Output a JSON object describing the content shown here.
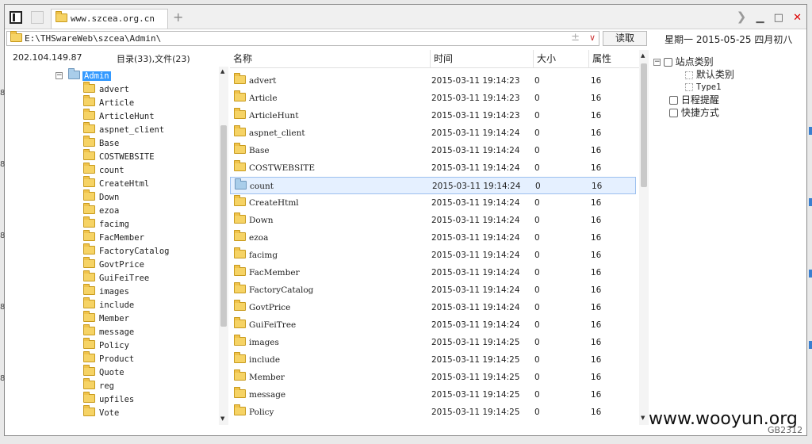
{
  "tab": {
    "title": "www.szcea.org.cn"
  },
  "address": {
    "path": "E:\\THSwareWeb\\szcea\\Admin\\",
    "read_button": "读取"
  },
  "date_display": "星期一  2015-05-25  四月初八",
  "status": {
    "ip": "202.104.149.87",
    "counts": "目录(33),文件(23)"
  },
  "tree": {
    "root": "Admin",
    "items": [
      "advert",
      "Article",
      "ArticleHunt",
      "aspnet_client",
      "Base",
      "COSTWEBSITE",
      "count",
      "CreateHtml",
      "Down",
      "ezoa",
      "facimg",
      "FacMember",
      "FactoryCatalog",
      "GovtPrice",
      "GuiFeiTree",
      "images",
      "include",
      "Member",
      "message",
      "Policy",
      "Product",
      "Quote",
      "reg",
      "upfiles",
      "Vote"
    ]
  },
  "list": {
    "columns": [
      "名称",
      "时间",
      "大小",
      "属性"
    ],
    "rows": [
      {
        "name": "advert",
        "time": "2015-03-11 19:14:23",
        "size": "0",
        "attr": "16"
      },
      {
        "name": "Article",
        "time": "2015-03-11 19:14:23",
        "size": "0",
        "attr": "16"
      },
      {
        "name": "ArticleHunt",
        "time": "2015-03-11 19:14:23",
        "size": "0",
        "attr": "16"
      },
      {
        "name": "aspnet_client",
        "time": "2015-03-11 19:14:24",
        "size": "0",
        "attr": "16"
      },
      {
        "name": "Base",
        "time": "2015-03-11 19:14:24",
        "size": "0",
        "attr": "16"
      },
      {
        "name": "COSTWEBSITE",
        "time": "2015-03-11 19:14:24",
        "size": "0",
        "attr": "16"
      },
      {
        "name": "count",
        "time": "2015-03-11 19:14:24",
        "size": "0",
        "attr": "16",
        "selected": true
      },
      {
        "name": "CreateHtml",
        "time": "2015-03-11 19:14:24",
        "size": "0",
        "attr": "16"
      },
      {
        "name": "Down",
        "time": "2015-03-11 19:14:24",
        "size": "0",
        "attr": "16"
      },
      {
        "name": "ezoa",
        "time": "2015-03-11 19:14:24",
        "size": "0",
        "attr": "16"
      },
      {
        "name": "facimg",
        "time": "2015-03-11 19:14:24",
        "size": "0",
        "attr": "16"
      },
      {
        "name": "FacMember",
        "time": "2015-03-11 19:14:24",
        "size": "0",
        "attr": "16"
      },
      {
        "name": "FactoryCatalog",
        "time": "2015-03-11 19:14:24",
        "size": "0",
        "attr": "16"
      },
      {
        "name": "GovtPrice",
        "time": "2015-03-11 19:14:24",
        "size": "0",
        "attr": "16"
      },
      {
        "name": "GuiFeiTree",
        "time": "2015-03-11 19:14:24",
        "size": "0",
        "attr": "16"
      },
      {
        "name": "images",
        "time": "2015-03-11 19:14:25",
        "size": "0",
        "attr": "16"
      },
      {
        "name": "include",
        "time": "2015-03-11 19:14:25",
        "size": "0",
        "attr": "16"
      },
      {
        "name": "Member",
        "time": "2015-03-11 19:14:25",
        "size": "0",
        "attr": "16"
      },
      {
        "name": "message",
        "time": "2015-03-11 19:14:25",
        "size": "0",
        "attr": "16"
      },
      {
        "name": "Policy",
        "time": "2015-03-11 19:14:25",
        "size": "0",
        "attr": "16"
      }
    ]
  },
  "right_panel": {
    "site_category": "站点类别",
    "default_category": "默认类别",
    "type1": "Type1",
    "schedule": "日程提醒",
    "shortcut": "快捷方式"
  },
  "watermark": "www.wooyun.org",
  "bottom_right_code": "GB2312"
}
